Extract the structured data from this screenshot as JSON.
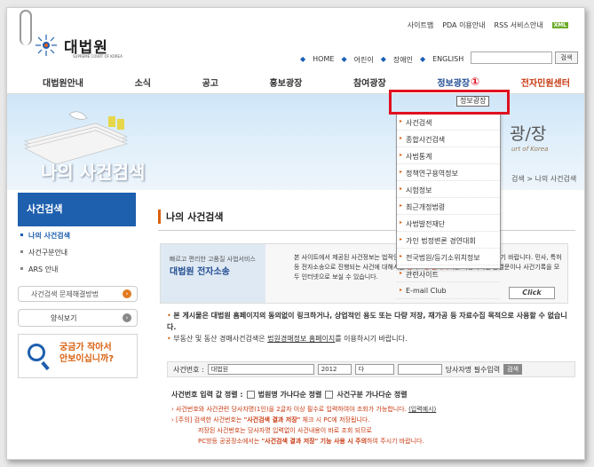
{
  "util": {
    "sitemap": "사이트맵",
    "pda": "PDA 이용안내",
    "rss": "RSS 서비스안내",
    "xml": "XML"
  },
  "logo": {
    "title": "대법원",
    "sub": "SUPREME COURT OF KOREA"
  },
  "topnav": [
    "HOME",
    "어린이",
    "장애인",
    "ENGLISH"
  ],
  "search": {
    "button": "검색",
    "placeholder": ""
  },
  "mainnav": [
    "대법원안내",
    "소식",
    "공고",
    "홍보광장",
    "참여광장",
    "정보광장",
    "전자민원센터"
  ],
  "marker": "①",
  "banner": {
    "label": "나의 사건검색",
    "title": "광/장",
    "sub": "urt of Korea",
    "crumb": "검색 > 나의 사건검색"
  },
  "dropdown": {
    "items": [
      "사건검색",
      "종합사건검색",
      "사법통계",
      "정책연구용역정보",
      "시험정보",
      "최근개정법령",
      "사법발전재단",
      "가인 법정변론 경연대회",
      "전국법원/등기소위치정보",
      "관련사이트",
      "E-mail Club"
    ],
    "tooltip": "정보광장"
  },
  "side": {
    "head": "사건검색",
    "items": [
      "나의 사건검색",
      "사건구분안내",
      "ARS 안내"
    ],
    "btn1": "사건검색 문제해결방법",
    "btn2": "양식보기",
    "help": [
      "궁금가 작아서",
      "안보이십니까?"
    ]
  },
  "content": {
    "title": "나의 사건검색",
    "ebox": {
      "t1": "빠르고 편리한 고품질 사법서비스",
      "t2": "대법원 전자소송",
      "msg1": "본 사이트에서 제공된 사건정보는 법적인 효력이 없으니, 참고자료로만 활용하시기 바랍니다.",
      "msg2": "민사, 특허 등 전자소송으로 진행되는 사건에 대해서는 ",
      "msg2hl": "전자소송 홈페이지",
      "msg2b": "를 이용하시면 판결문이나 사건기록을 모두 인터넷으로 보실 수 있습니다.",
      "click": "Click"
    },
    "notes": {
      "n1": "본 게시물은 대법원 홈페이지의 동의없이 링크하거나, 상업적인 용도 또는 다량 저장, 재가공 등 자료수집 목적으로 사용할 수 없습니다.",
      "n2a": "부동산 및 동산 경매사건검색은 ",
      "n2link": "법원경매정보 홈페이지",
      "n2b": "를 이용하시기 바랍니다."
    },
    "form": {
      "label": "사건번호 :",
      "court": "대법원",
      "year": "2012",
      "type": "다",
      "ph": "당사자명 필수입력",
      "btn": "검색"
    },
    "sort": {
      "label": "사건번호 입력 값 정렬 :",
      "opt1": "법원명 가나다순 정렬",
      "opt2": "사건구분 가나다순 정렬"
    },
    "warn": {
      "w1": "사건번호와 사건관련 당사자명(1인)을 2글자 이상 필수로 입력하여야 조회가 가능합니다. ",
      "w1link": "(입력예시)",
      "tag": "[주의]",
      "w2a": "검색한 사건번호는 ",
      "w2k": "\"사건검색 결과 저장\"",
      "w2b": " 체크 시 PC에 저장됩니다.",
      "w3": "저장된 사건번호는 당사자명 입력없이 사건내용이 바로 조회 되므로",
      "w4a": "PC방등 공공장소에서는 ",
      "w4k": "\"사건검색 결과 저장\" 기능 사용 시 주의",
      "w4b": "하여 주시기 바랍니다."
    }
  }
}
